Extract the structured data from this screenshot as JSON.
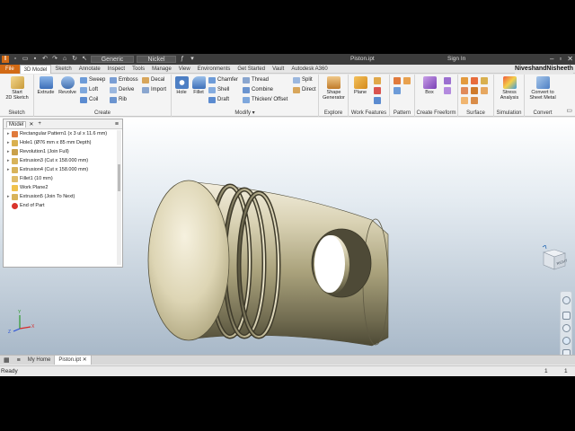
{
  "titlebar": {
    "material": "Generic",
    "appearance": "Nickel",
    "document": "Piston.ipt",
    "signin": "Sign In"
  },
  "tabs": [
    "File",
    "3D Model",
    "Sketch",
    "Annotate",
    "Inspect",
    "Tools",
    "Manage",
    "View",
    "Environments",
    "Get Started",
    "Vault",
    "Autodesk A360"
  ],
  "active_tab": "3D Model",
  "user_name": "NiveshandNisheeth",
  "ribbon": {
    "sketch": {
      "start": "Start",
      "start2": "2D Sketch",
      "panel": "Sketch"
    },
    "create": {
      "extrude": "Extrude",
      "revolve": "Revolve",
      "sweep": "Sweep",
      "loft": "Loft",
      "coil": "Coil",
      "emboss": "Emboss",
      "derive": "Derive",
      "rib": "Rib",
      "decal": "Decal",
      "import": "Import",
      "panel": "Create"
    },
    "modify": {
      "hole": "Hole",
      "fillet": "Fillet",
      "chamfer": "Chamfer",
      "shell": "Shell",
      "draft": "Draft",
      "thread": "Thread",
      "combine": "Combine",
      "thicken": "Thicken/ Offset",
      "split": "Split",
      "direct": "Direct",
      "panel": "Modify"
    },
    "explore": {
      "shape1": "Shape",
      "shape2": "Generator",
      "panel": "Explore"
    },
    "work_features": {
      "plane": "Plane",
      "panel": "Work Features"
    },
    "pattern": {
      "panel": "Pattern"
    },
    "freeform": {
      "box": "Box",
      "panel": "Create Freeform"
    },
    "surface": {
      "panel": "Surface"
    },
    "simulation": {
      "stress1": "Stress",
      "stress2": "Analysis",
      "panel": "Simulation"
    },
    "convert": {
      "sheet1": "Convert to",
      "sheet2": "Sheet Metal",
      "panel": "Convert"
    }
  },
  "browser": {
    "tabs": [
      "Model",
      "+"
    ],
    "items": [
      "Rectangular Pattern1 (x 3 ul x 11.6 mm)",
      "Hole1 (Ø76 mm x 85 mm Depth)",
      "Revolution1 (Join Full)",
      "Extrusion3 (Cut x 158.000 mm)",
      "Extrusion4 (Cut x 158.000 mm)",
      "Fillet1 (10 mm)",
      "Work Plane2",
      "Extrusion5 (Join To Next)",
      "End of Part"
    ]
  },
  "viewcube_label": "RIGHT",
  "triad": {
    "y": "Y",
    "x": "X",
    "z": "Z"
  },
  "doctabs": [
    "My Home",
    "Piston.ipt"
  ],
  "status": {
    "text": "Ready",
    "n1": "1",
    "n2": "1"
  }
}
